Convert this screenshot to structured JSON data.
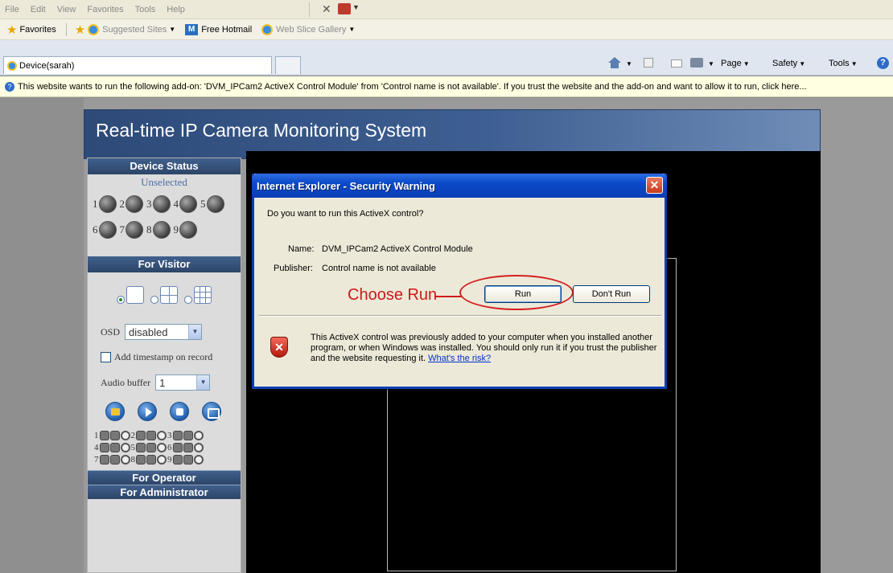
{
  "browser": {
    "menu": [
      "File",
      "Edit",
      "View",
      "Favorites",
      "Tools",
      "Help"
    ],
    "favorites_label": "Favorites",
    "suggested_sites": "Suggested Sites",
    "free_hotmail": "Free Hotmail",
    "web_slice": "Web Slice Gallery",
    "tab_title": "Device(sarah)",
    "cmd_page": "Page",
    "cmd_safety": "Safety",
    "cmd_tools": "Tools",
    "infobar_text": "This website wants to run the following add-on: 'DVM_IPCam2 ActiveX Control Module' from 'Control name is not available'. If you trust the website and the add-on and want to allow it to run, click here..."
  },
  "page": {
    "title": "Real-time IP Camera Monitoring System"
  },
  "sidebar": {
    "device_status": "Device Status",
    "unselected": "Unselected",
    "devices_row1": [
      "1",
      "2",
      "3",
      "4",
      "5"
    ],
    "devices_row2": [
      "6",
      "7",
      "8",
      "9"
    ],
    "for_visitor": "For Visitor",
    "osd_label": "OSD",
    "osd_value": "disabled",
    "timestamp_label": "Add timestamp on record",
    "audio_label": "Audio buffer",
    "audio_value": "1",
    "channels": [
      "1",
      "2",
      "3",
      "4",
      "5",
      "6",
      "7",
      "8",
      "9"
    ],
    "for_operator": "For Operator",
    "for_administrator": "For Administrator"
  },
  "dialog": {
    "title": "Internet Explorer - Security Warning",
    "question": "Do you want to run this ActiveX control?",
    "name_label": "Name:",
    "name_value": "DVM_IPCam2 ActiveX Control Module",
    "publisher_label": "Publisher:",
    "publisher_value": "Control name is not available",
    "annotation": "Choose Run",
    "run_button": "Run",
    "dont_run_button": "Don't Run",
    "warning_text": "This ActiveX control was previously added to your computer when you installed another program, or when Windows was installed. You should only run it if you trust the publisher and the website requesting it.",
    "risk_link": "What's the risk?"
  },
  "colors": {
    "dialog_title": "#0a49c9",
    "annotation": "#cc1a1a",
    "sidebar_header": "#2c4568"
  }
}
